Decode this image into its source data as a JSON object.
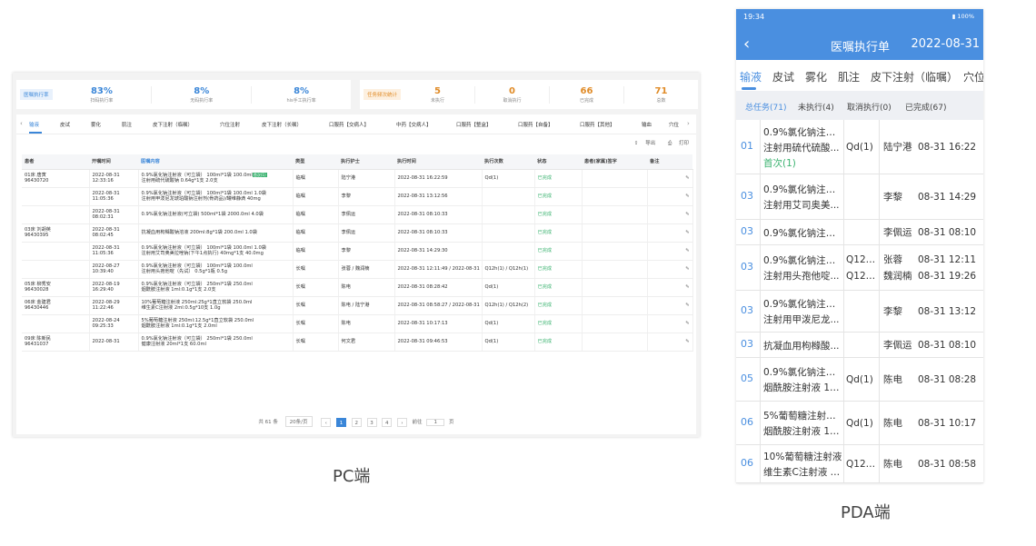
{
  "pc": {
    "label": "PC端",
    "statsA": {
      "badge": "医嘱执行率",
      "items": [
        {
          "value": "83%",
          "label": "扫码执行率"
        },
        {
          "value": "8%",
          "label": "无码执行率"
        },
        {
          "value": "8%",
          "label": "his手工执行率"
        }
      ]
    },
    "statsB": {
      "badge": "任务频次统计",
      "items": [
        {
          "value": "5",
          "label": "未执行"
        },
        {
          "value": "0",
          "label": "取消执行"
        },
        {
          "value": "66",
          "label": "已完成"
        },
        {
          "value": "71",
          "label": "总数"
        }
      ]
    },
    "tabs": [
      "输液",
      "皮试",
      "雾化",
      "肌注",
      "皮下注射（临嘱）",
      "穴位注射",
      "皮下注射（长嘱）",
      "口服药【交病人】",
      "中药【交病人】",
      "口服药【整盒】",
      "口服药【自备】",
      "口服药【其他】",
      "输血",
      "穴位"
    ],
    "export": "导出",
    "print": "打印",
    "columns": [
      "患者",
      "开嘱时间",
      "医嘱内容",
      "类型",
      "执行护士",
      "执行时间",
      "执行次数",
      "状态",
      "患者(家属)签字",
      "备注"
    ],
    "rows": [
      {
        "patient": "01床 唐寅",
        "pid": "96430720",
        "date": "2022-08-31",
        "time": "12:33:16",
        "content1": "0.9%氯化钠注射液（可立袋） 100ml*1袋 100.0ml",
        "content2": "注射用硫代硫酸钠 0.64g*1支 2.0支",
        "tag": "首次(1)",
        "type": "临嘱",
        "nurse": "陆宁港",
        "exec": "2022-08-31 16:22:59",
        "count": "Qd(1)",
        "status": "已完成"
      },
      {
        "patient": "",
        "pid": "",
        "date": "2022-08-31",
        "time": "11:05:36",
        "content1": "0.9%氯化钠注射液（可立袋） 100ml*1袋 100.0ml 1.0袋",
        "content2": "注射用甲泼尼龙琥珀酸钠注射剂(骨药品)/罐维静滴 40mg",
        "tag": "",
        "type": "临嘱",
        "nurse": "李黎",
        "exec": "2022-08-31 13:12:56",
        "count": "",
        "status": "已完成"
      },
      {
        "patient": "",
        "pid": "",
        "date": "2022-08-31",
        "time": "08:02:31",
        "content1": "0.9%氯化钠注射液(可立袋) 500ml*1袋 2000.0ml 4.0袋",
        "content2": "",
        "tag": "",
        "type": "临嘱",
        "nurse": "李佩运",
        "exec": "2022-08-31 08:10:33",
        "count": "",
        "status": "已完成"
      },
      {
        "patient": "03床 刘胡英",
        "pid": "96430395",
        "date": "2022-08-31",
        "time": "08:02:45",
        "content1": "抗凝血用枸橼酸钠溶液 200ml:8g*1袋 200.0ml 1.0袋",
        "content2": "",
        "tag": "",
        "type": "临嘱",
        "nurse": "李佩运",
        "exec": "2022-08-31 08:10:33",
        "count": "",
        "status": "已完成"
      },
      {
        "patient": "",
        "pid": "",
        "date": "2022-08-31",
        "time": "11:05:36",
        "content1": "0.9%氯化钠注射液（可立袋） 100ml*1袋 100.0ml 1.0袋",
        "content2": "注射用艾司奥美拉唑钠(下午1点执行) 40mg*1支 40.0mg",
        "tag": "",
        "type": "临嘱",
        "nurse": "李黎",
        "exec": "2022-08-31 14:29:30",
        "count": "",
        "status": "已完成"
      },
      {
        "patient": "",
        "pid": "",
        "date": "2022-08-27",
        "time": "10:39:40",
        "content1": "0.9%氯化钠注射液（可立袋） 100ml*1袋 100.0ml",
        "content2": "注射用头孢他啶（先试） 0.5g*1瓶 0.5g",
        "tag": "",
        "type": "长嘱",
        "nurse": "张蓉 / 魏润楠",
        "exec": "2022-08-31 12:11:49 / 2022-08-31 19:26:17",
        "count": "Q12h(1) / Q12h(1)",
        "status": "已完成"
      },
      {
        "patient": "05床 柳秀安",
        "pid": "96430028",
        "date": "2022-08-19",
        "time": "16:29:40",
        "content1": "0.9%氯化钠注射液（可立袋） 250ml*1袋 250.0ml",
        "content2": "烟酰胺注射液 1ml:0.1g*1支 2.0支",
        "tag": "",
        "type": "长嘱",
        "nurse": "陈电",
        "exec": "2022-08-31 08:28:42",
        "count": "Qd(1)",
        "status": "已完成"
      },
      {
        "patient": "06床 金建君",
        "pid": "96430446",
        "date": "2022-08-29",
        "time": "11:22:46",
        "content1": "10%葡萄糖注射液 250ml:25g*1直立软袋 250.0ml",
        "content2": "维生素C注射液 2ml:0.5g*10支 1.0g",
        "tag": "",
        "type": "长嘱",
        "nurse": "陈电 / 陆宁港",
        "exec": "2022-08-31 08:58:27 / 2022-08-31 16:28:55",
        "count": "Q12h(1) / Q12h(2)",
        "status": "已完成"
      },
      {
        "patient": "",
        "pid": "",
        "date": "2022-08-24",
        "time": "09:25:33",
        "content1": "5%葡萄糖注射液 250ml:12.5g*1直立软袋 250.0ml",
        "content2": "烟酰胺注射液 1ml:0.1g*1支 2.0ml",
        "tag": "",
        "type": "长嘱",
        "nurse": "陈电",
        "exec": "2022-08-31 10:17:13",
        "count": "Qd(1)",
        "status": "已完成"
      },
      {
        "patient": "09床 陈新民",
        "pid": "96431037",
        "date": "2022-08-31",
        "time": "",
        "content1": "0.9%氯化钠注射液（可立袋） 250ml*1袋 250.0ml",
        "content2": "健康注射液 20ml*1支 60.0ml",
        "tag": "",
        "type": "长嘱",
        "nurse": "何文君",
        "exec": "2022-08-31 09:46:53",
        "count": "Qd(1)",
        "status": "已完成"
      }
    ],
    "pager": {
      "total": "共 61 条",
      "size": "20条/页",
      "pages": [
        "1",
        "2",
        "3",
        "4"
      ],
      "goto": "前往",
      "page": "1",
      "unit": "页"
    }
  },
  "pda": {
    "label": "PDA端",
    "status_time": "19:34",
    "status_right": "100%",
    "title": "医嘱执行单",
    "date": "2022-08-31",
    "tabs": [
      "输液",
      "皮试",
      "雾化",
      "肌注",
      "皮下注射（临嘱）",
      "穴位"
    ],
    "filters": [
      "总任务(71)",
      "未执行(4)",
      "取消执行(0)",
      "已完成(67)"
    ],
    "rows": [
      {
        "no": "01",
        "l1": "0.9%氯化钠注射...",
        "l2": "注射用硫代硫酸...",
        "l3": "首次(1)",
        "f1": "Qd(1)",
        "f2": "",
        "n1": "陆宁港",
        "n2": "",
        "t1": "08-31 16:22",
        "t2": ""
      },
      {
        "no": "03",
        "l1": "0.9%氯化钠注射...",
        "l2": "注射用艾司奥美...",
        "l3": "",
        "f1": "",
        "f2": "",
        "n1": "李黎",
        "n2": "",
        "t1": "08-31 14:29",
        "t2": ""
      },
      {
        "no": "03",
        "l1": "0.9%氯化钠注射...",
        "l2": "",
        "l3": "",
        "f1": "",
        "f2": "",
        "n1": "李佩运",
        "n2": "",
        "t1": "08-31 08:10",
        "t2": ""
      },
      {
        "no": "03",
        "l1": "0.9%氯化钠注射...",
        "l2": "注射用头孢他啶...",
        "l3": "",
        "f1": "Q12h...",
        "f2": "Q12h...",
        "n1": "张蓉",
        "n2": "魏润楠",
        "t1": "08-31 12:11",
        "t2": "08-31 19:26"
      },
      {
        "no": "03",
        "l1": "0.9%氯化钠注射...",
        "l2": "注射用甲泼尼龙...",
        "l3": "",
        "f1": "",
        "f2": "",
        "n1": "李黎",
        "n2": "",
        "t1": "08-31 13:12",
        "t2": ""
      },
      {
        "no": "03",
        "l1": "抗凝血用枸橼酸...",
        "l2": "",
        "l3": "",
        "f1": "",
        "f2": "",
        "n1": "李佩运",
        "n2": "",
        "t1": "08-31 08:10",
        "t2": ""
      },
      {
        "no": "05",
        "l1": "0.9%氯化钠注射...",
        "l2": "烟酰胺注射液 1m...",
        "l3": "",
        "f1": "Qd(1)",
        "f2": "",
        "n1": "陈电",
        "n2": "",
        "t1": "08-31 08:28",
        "t2": ""
      },
      {
        "no": "06",
        "l1": "5%葡萄糖注射液 ...",
        "l2": "烟酰胺注射液 1m...",
        "l3": "",
        "f1": "Qd(1)",
        "f2": "",
        "n1": "陈电",
        "n2": "",
        "t1": "08-31 10:17",
        "t2": ""
      },
      {
        "no": "06",
        "l1": "10%葡萄糖注射液",
        "l2": "维生素C注射液 2...",
        "l3": "",
        "f1": "Q12h...",
        "f2": "",
        "n1": "陈电",
        "n2": "",
        "t1": "08-31 08:58",
        "t2": ""
      }
    ]
  }
}
